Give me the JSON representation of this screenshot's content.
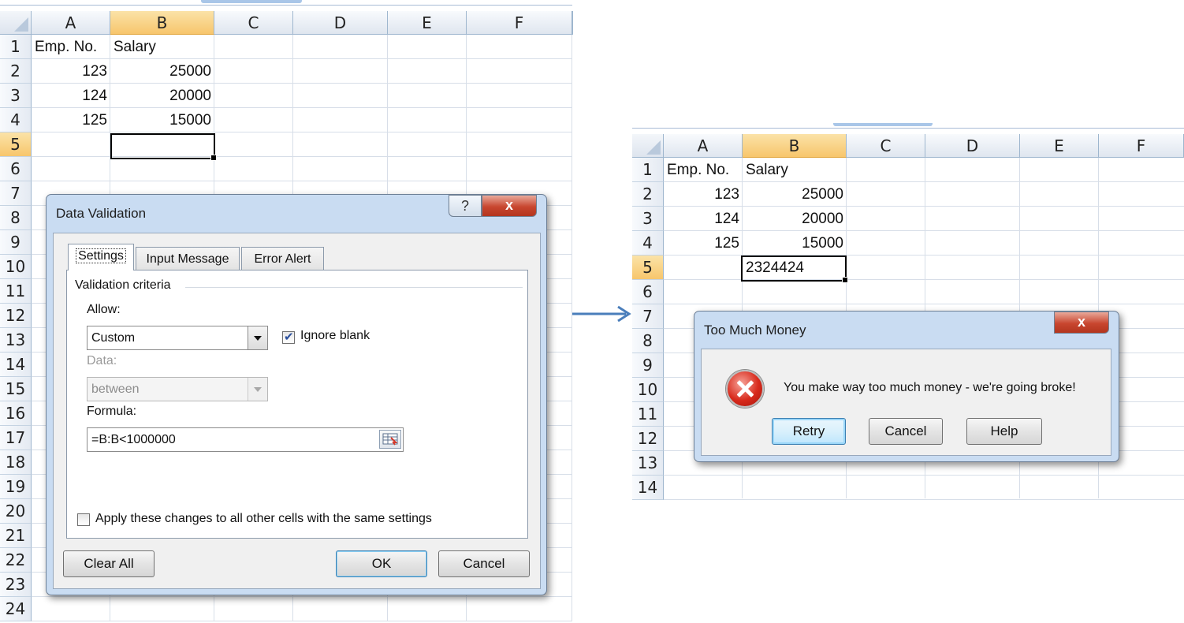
{
  "columns": [
    "A",
    "B",
    "C",
    "D",
    "E",
    "F"
  ],
  "selected_column": "B",
  "left_sheet": {
    "rows": [
      "1",
      "2",
      "3",
      "4",
      "5",
      "6",
      "7",
      "8",
      "9",
      "10",
      "11",
      "12",
      "13",
      "14",
      "15",
      "16",
      "17",
      "18",
      "19",
      "20",
      "21",
      "22",
      "23",
      "24"
    ],
    "selected_row": "5",
    "cells": [
      [
        "Emp. No.",
        "Salary"
      ],
      [
        "123",
        "25000"
      ],
      [
        "124",
        "20000"
      ],
      [
        "125",
        "15000"
      ],
      [
        "",
        ""
      ]
    ]
  },
  "right_sheet": {
    "rows": [
      "1",
      "2",
      "3",
      "4",
      "5",
      "6",
      "7",
      "8",
      "9",
      "10",
      "11",
      "12",
      "13",
      "14"
    ],
    "selected_row": "5",
    "cells": [
      [
        "Emp. No.",
        "Salary"
      ],
      [
        "123",
        "25000"
      ],
      [
        "124",
        "20000"
      ],
      [
        "125",
        "15000"
      ],
      [
        "",
        "2324424"
      ]
    ]
  },
  "data_validation_dialog": {
    "title": "Data Validation",
    "help_glyph": "?",
    "close_glyph": "x",
    "tabs": [
      "Settings",
      "Input Message",
      "Error Alert"
    ],
    "active_tab": "Settings",
    "group_label": "Validation criteria",
    "allow_label": "Allow:",
    "allow_value": "Custom",
    "ignore_blank_label": "Ignore blank",
    "ignore_blank_checked": true,
    "data_label": "Data:",
    "data_value": "between",
    "formula_label": "Formula:",
    "formula_value": "=B:B<1000000",
    "apply_label": "Apply these changes to all other cells with the same settings",
    "apply_checked": false,
    "clear_all_label": "Clear All",
    "ok_label": "OK",
    "cancel_label": "Cancel"
  },
  "error_dialog": {
    "title": "Too Much Money",
    "close_glyph": "x",
    "message": "You make way too much money - we're going broke!",
    "icon": "error-icon",
    "retry_label": "Retry",
    "cancel_label": "Cancel",
    "help_label": "Help"
  },
  "colors": {
    "selected_header": "#f7c66c",
    "dialog_frame": "#c9dcf2",
    "close_button": "#c8462f",
    "arrow": "#4a7ebb"
  }
}
